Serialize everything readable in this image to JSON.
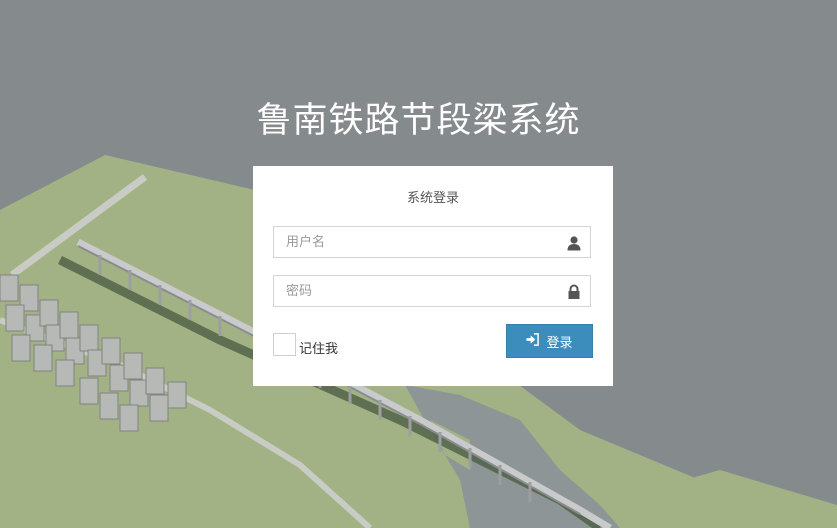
{
  "app_title": "鲁南铁路节段梁系统",
  "login": {
    "panel_title": "系统登录",
    "username_placeholder": "用户名",
    "password_placeholder": "密码",
    "remember_label": "记住我",
    "submit_label": "登录"
  },
  "icons": {
    "username": "user-icon",
    "password": "lock-icon",
    "submit": "sign-in-icon"
  },
  "colors": {
    "background": "#858a8d",
    "terrain": "#a3b285",
    "primary_button": "#3c8dbc"
  }
}
